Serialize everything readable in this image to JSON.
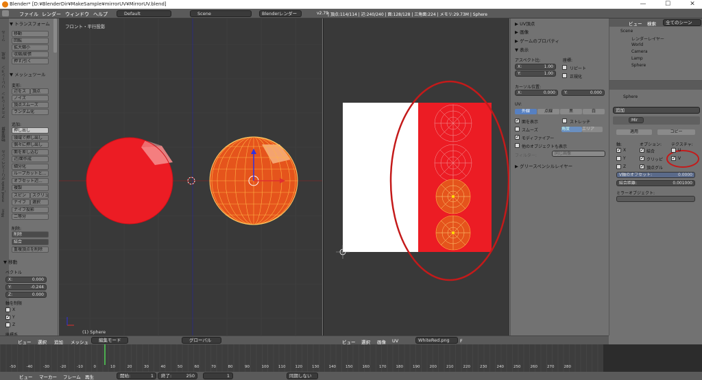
{
  "window": {
    "title": "Blender* [D:¥BlenderDir¥MakeSample¥mirrorUV¥MirrorUV.blend]",
    "minimize": "—",
    "maximize": "☐",
    "close": "✕"
  },
  "menu": {
    "items": [
      "ファイル",
      "レンダー",
      "ウィンドウ",
      "ヘルプ"
    ],
    "layout": "Default",
    "scene": "Scene",
    "engine": "Blenderレンダー",
    "version": "v2.79",
    "stats": "| 頂点:114/114 | 辺:240/240 | 面:128/128 | 三角面:224 | メモリ:29.73M | Sphere"
  },
  "toolshelf": {
    "tabs": [
      "ツール",
      "作成",
      "リレーション",
      "アニメーション",
      "物理演算",
      "グリースペンシル",
      "mmd_tools",
      "Misc"
    ],
    "transform_header": "▼ トランスフォーム",
    "transform_buttons": [
      "移動",
      "回転",
      "拡大縮小",
      "収縮/膨張",
      "押す/引く"
    ],
    "mesh_tools_header": "▼ メッシュツール",
    "deform_label": "変形:",
    "deform_rows": [
      [
        "辺をス",
        "頂点"
      ],
      [
        "ノイズ"
      ],
      [
        "頂点スムーズ"
      ],
      [
        "ランダム化"
      ]
    ],
    "add_label": "追加:",
    "add_rows": [
      [
        "押し出し"
      ],
      [
        "領域で押し出し"
      ],
      [
        "個々に押し出し"
      ],
      [
        "面を差し込む"
      ],
      [
        "辺/面作成"
      ],
      [
        "細分化"
      ],
      [
        "ループカットと..."
      ],
      [
        "オフセット辺..."
      ],
      [
        "複製"
      ],
      [
        "スピン",
        "スクリュ"
      ],
      [
        "ナイフ",
        "選択"
      ],
      [
        "ナイフ投影"
      ],
      [
        "二等分"
      ]
    ],
    "delete_label": "削除:",
    "delete_value": "削除",
    "merge_value": "結合",
    "remove_doubles": "重複頂点を削除",
    "move_header": "▼ 移動",
    "vector_label": "ベクトル",
    "vector": [
      {
        "axis": "X:",
        "value": "0.000"
      },
      {
        "axis": "Y:",
        "value": "-0.244"
      },
      {
        "axis": "Z:",
        "value": "0.000"
      }
    ],
    "constraint_label": "軸を制限",
    "constraint_axes": [
      "X",
      "Y",
      "Z"
    ],
    "orientation_label": "座標系"
  },
  "viewport": {
    "label": "フロント・平行投影",
    "object_label": "(1) Sphere",
    "header": {
      "items": [
        "ビュー",
        "選択",
        "追加",
        "メッシュ"
      ],
      "mode": "編集モード",
      "orientation": "グローバル"
    }
  },
  "uv_editor": {
    "header": {
      "items": [
        "ビュー",
        "選択",
        "画像",
        "UV"
      ],
      "image": "WhiteRed.png",
      "image_flag": "F"
    }
  },
  "uv_panel": {
    "sections": [
      "▶ UV頂点",
      "▶ 画像",
      "▶ ゲームのプロパティ",
      "▼ 表示"
    ],
    "aspect_label": "アスペクト比:",
    "aspect": [
      {
        "axis": "X:",
        "value": "1.00"
      },
      {
        "axis": "Y:",
        "value": "1.00"
      }
    ],
    "coord_label": "座標:",
    "repeat": "リピート",
    "normalize": "正規化",
    "cursor_label": "カーソル位置:",
    "cursor": [
      {
        "axis": "X:",
        "value": "0.000"
      },
      {
        "axis": "Y:",
        "value": "0.000"
      }
    ],
    "uv_label": "UV:",
    "uv_modes": [
      "外線",
      "点線",
      "黒",
      "白"
    ],
    "show_faces": "面を表示",
    "stretch": "ストレッチ",
    "smooth": "スムーズ",
    "stretch_modes": [
      "角度",
      "エリア"
    ],
    "modified": "モディファイアー",
    "other_objects": "他のオブジェクトも表示",
    "filter_label": "フィルター:",
    "filter_value": "同じ画像",
    "grease_pencil": "▶ グリースペンシルレイヤー"
  },
  "outliner": {
    "header": {
      "view": "ビュー",
      "search": "検索",
      "filter": "全てのシーン"
    },
    "items": [
      {
        "name": "Scene",
        "indent": 0
      },
      {
        "name": "レンダーレイヤー",
        "indent": 1
      },
      {
        "name": "World",
        "indent": 1
      },
      {
        "name": "Camera",
        "indent": 1
      },
      {
        "name": "Lamp",
        "indent": 1
      },
      {
        "name": "Sphere",
        "indent": 1
      }
    ]
  },
  "properties": {
    "object": "Sphere",
    "add_modifier": "追加",
    "modifier_name": "Mir",
    "apply": "適用",
    "copy": "コピー",
    "axis_label": "軸:",
    "options_label": "オプション:",
    "texture_label": "テクスチャ:",
    "axes": [
      "X",
      "Y",
      "Z"
    ],
    "options": [
      "結合",
      "クリッピ",
      "頂点グル"
    ],
    "textures": [
      "U",
      "V"
    ],
    "v_offset_label": "V軸のオフセット:",
    "v_offset": "0.0000",
    "merge_limit_label": "結合距離:",
    "merge_limit": "0.001000",
    "mirror_object_label": "ミラーオブジェクト:"
  },
  "timeline": {
    "ticks": [
      "-50",
      "-40",
      "-30",
      "-20",
      "-10",
      "0",
      "10",
      "20",
      "30",
      "40",
      "50",
      "60",
      "70",
      "80",
      "90",
      "100",
      "110",
      "120",
      "130",
      "140",
      "150",
      "160",
      "170",
      "180",
      "190",
      "200",
      "210",
      "220",
      "230",
      "240",
      "250",
      "260",
      "270",
      "280"
    ],
    "current_frame": 1,
    "header": {
      "items": [
        "ビュー",
        "マーカー",
        "フレーム",
        "再生"
      ],
      "start_label": "開始:",
      "start": "1",
      "end_label": "終了:",
      "end": "250",
      "current": "1",
      "sync": "同期しない"
    }
  },
  "colors": {
    "red": "#ec1c24",
    "selected_orange": "#e5541c",
    "annotation": "#c41a1a",
    "panel": "#727272",
    "viewport": "#393939"
  }
}
